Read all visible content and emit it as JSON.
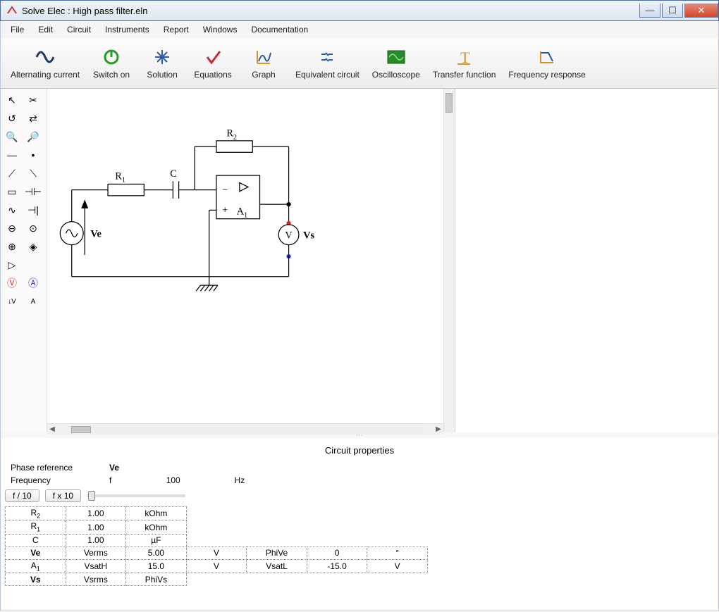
{
  "window": {
    "title": "Solve Elec : High pass filter.eln"
  },
  "menu": {
    "items": [
      "File",
      "Edit",
      "Circuit",
      "Instruments",
      "Report",
      "Windows",
      "Documentation"
    ]
  },
  "toolbar": {
    "items": [
      {
        "label": "Alternating current"
      },
      {
        "label": "Switch on"
      },
      {
        "label": "Solution"
      },
      {
        "label": "Equations"
      },
      {
        "label": "Graph"
      },
      {
        "label": "Equivalent circuit"
      },
      {
        "label": "Oscilloscope"
      },
      {
        "label": "Transfer function"
      },
      {
        "label": "Frequency response"
      }
    ]
  },
  "circuit": {
    "labels": {
      "R1": "R",
      "R1sub": "1",
      "R2": "R",
      "R2sub": "2",
      "C": "C",
      "A1": "A",
      "A1sub": "1",
      "Ve": "Ve",
      "Vs": "Vs",
      "V": "V"
    }
  },
  "properties": {
    "title": "Circuit properties",
    "phase_ref_label": "Phase reference",
    "phase_ref_value": "Ve",
    "freq_label": "Frequency",
    "freq_sym": "f",
    "freq_val": "100",
    "freq_unit": "Hz",
    "btn_div": "f / 10",
    "btn_mul": "f x 10",
    "rows_simple": [
      {
        "name": "R",
        "sub": "2",
        "val": "1.00",
        "unit": "kOhm"
      },
      {
        "name": "R",
        "sub": "1",
        "val": "1.00",
        "unit": "kOhm"
      },
      {
        "name": "C",
        "sub": "",
        "val": "1.00",
        "unit": "µF"
      }
    ],
    "rows_ext": [
      {
        "name": "Ve",
        "p1": "Verms",
        "p2": "5.00",
        "p3": "V",
        "p4": "PhiVe",
        "p5": "0",
        "p6": "°"
      },
      {
        "name": "A",
        "sub": "1",
        "p1": "VsatH",
        "p2": "15.0",
        "p3": "V",
        "p4": "VsatL",
        "p5": "-15.0",
        "p6": "V"
      },
      {
        "name": "Vs",
        "p1": "Vsrms",
        "p2": "PhiVs",
        "p3": "",
        "p4": "",
        "p5": "",
        "p6": ""
      }
    ]
  }
}
